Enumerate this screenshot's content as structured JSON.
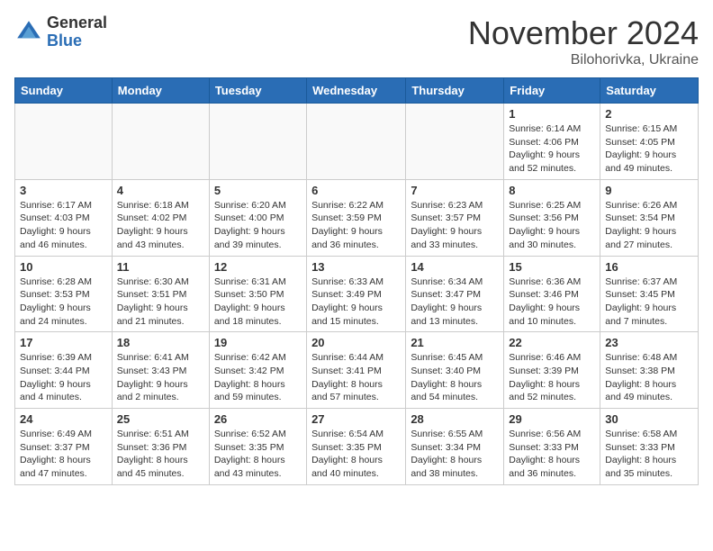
{
  "logo": {
    "general": "General",
    "blue": "Blue"
  },
  "title": "November 2024",
  "location": "Bilohorivka, Ukraine",
  "weekdays": [
    "Sunday",
    "Monday",
    "Tuesday",
    "Wednesday",
    "Thursday",
    "Friday",
    "Saturday"
  ],
  "weeks": [
    [
      {
        "day": "",
        "info": ""
      },
      {
        "day": "",
        "info": ""
      },
      {
        "day": "",
        "info": ""
      },
      {
        "day": "",
        "info": ""
      },
      {
        "day": "",
        "info": ""
      },
      {
        "day": "1",
        "info": "Sunrise: 6:14 AM\nSunset: 4:06 PM\nDaylight: 9 hours\nand 52 minutes."
      },
      {
        "day": "2",
        "info": "Sunrise: 6:15 AM\nSunset: 4:05 PM\nDaylight: 9 hours\nand 49 minutes."
      }
    ],
    [
      {
        "day": "3",
        "info": "Sunrise: 6:17 AM\nSunset: 4:03 PM\nDaylight: 9 hours\nand 46 minutes."
      },
      {
        "day": "4",
        "info": "Sunrise: 6:18 AM\nSunset: 4:02 PM\nDaylight: 9 hours\nand 43 minutes."
      },
      {
        "day": "5",
        "info": "Sunrise: 6:20 AM\nSunset: 4:00 PM\nDaylight: 9 hours\nand 39 minutes."
      },
      {
        "day": "6",
        "info": "Sunrise: 6:22 AM\nSunset: 3:59 PM\nDaylight: 9 hours\nand 36 minutes."
      },
      {
        "day": "7",
        "info": "Sunrise: 6:23 AM\nSunset: 3:57 PM\nDaylight: 9 hours\nand 33 minutes."
      },
      {
        "day": "8",
        "info": "Sunrise: 6:25 AM\nSunset: 3:56 PM\nDaylight: 9 hours\nand 30 minutes."
      },
      {
        "day": "9",
        "info": "Sunrise: 6:26 AM\nSunset: 3:54 PM\nDaylight: 9 hours\nand 27 minutes."
      }
    ],
    [
      {
        "day": "10",
        "info": "Sunrise: 6:28 AM\nSunset: 3:53 PM\nDaylight: 9 hours\nand 24 minutes."
      },
      {
        "day": "11",
        "info": "Sunrise: 6:30 AM\nSunset: 3:51 PM\nDaylight: 9 hours\nand 21 minutes."
      },
      {
        "day": "12",
        "info": "Sunrise: 6:31 AM\nSunset: 3:50 PM\nDaylight: 9 hours\nand 18 minutes."
      },
      {
        "day": "13",
        "info": "Sunrise: 6:33 AM\nSunset: 3:49 PM\nDaylight: 9 hours\nand 15 minutes."
      },
      {
        "day": "14",
        "info": "Sunrise: 6:34 AM\nSunset: 3:47 PM\nDaylight: 9 hours\nand 13 minutes."
      },
      {
        "day": "15",
        "info": "Sunrise: 6:36 AM\nSunset: 3:46 PM\nDaylight: 9 hours\nand 10 minutes."
      },
      {
        "day": "16",
        "info": "Sunrise: 6:37 AM\nSunset: 3:45 PM\nDaylight: 9 hours\nand 7 minutes."
      }
    ],
    [
      {
        "day": "17",
        "info": "Sunrise: 6:39 AM\nSunset: 3:44 PM\nDaylight: 9 hours\nand 4 minutes."
      },
      {
        "day": "18",
        "info": "Sunrise: 6:41 AM\nSunset: 3:43 PM\nDaylight: 9 hours\nand 2 minutes."
      },
      {
        "day": "19",
        "info": "Sunrise: 6:42 AM\nSunset: 3:42 PM\nDaylight: 8 hours\nand 59 minutes."
      },
      {
        "day": "20",
        "info": "Sunrise: 6:44 AM\nSunset: 3:41 PM\nDaylight: 8 hours\nand 57 minutes."
      },
      {
        "day": "21",
        "info": "Sunrise: 6:45 AM\nSunset: 3:40 PM\nDaylight: 8 hours\nand 54 minutes."
      },
      {
        "day": "22",
        "info": "Sunrise: 6:46 AM\nSunset: 3:39 PM\nDaylight: 8 hours\nand 52 minutes."
      },
      {
        "day": "23",
        "info": "Sunrise: 6:48 AM\nSunset: 3:38 PM\nDaylight: 8 hours\nand 49 minutes."
      }
    ],
    [
      {
        "day": "24",
        "info": "Sunrise: 6:49 AM\nSunset: 3:37 PM\nDaylight: 8 hours\nand 47 minutes."
      },
      {
        "day": "25",
        "info": "Sunrise: 6:51 AM\nSunset: 3:36 PM\nDaylight: 8 hours\nand 45 minutes."
      },
      {
        "day": "26",
        "info": "Sunrise: 6:52 AM\nSunset: 3:35 PM\nDaylight: 8 hours\nand 43 minutes."
      },
      {
        "day": "27",
        "info": "Sunrise: 6:54 AM\nSunset: 3:35 PM\nDaylight: 8 hours\nand 40 minutes."
      },
      {
        "day": "28",
        "info": "Sunrise: 6:55 AM\nSunset: 3:34 PM\nDaylight: 8 hours\nand 38 minutes."
      },
      {
        "day": "29",
        "info": "Sunrise: 6:56 AM\nSunset: 3:33 PM\nDaylight: 8 hours\nand 36 minutes."
      },
      {
        "day": "30",
        "info": "Sunrise: 6:58 AM\nSunset: 3:33 PM\nDaylight: 8 hours\nand 35 minutes."
      }
    ]
  ]
}
